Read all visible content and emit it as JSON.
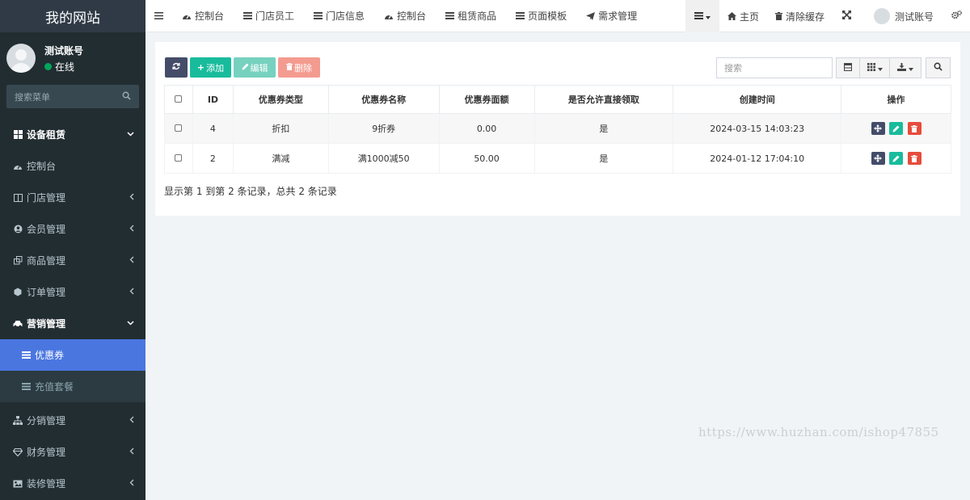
{
  "sidebar": {
    "logo": "我的网站",
    "user": {
      "name": "测试账号",
      "status": "在线"
    },
    "search_placeholder": "搜索菜单",
    "items": [
      {
        "label": "设备租赁",
        "icon": "grid-icon"
      },
      {
        "label": "控制台",
        "icon": "dashboard-icon"
      },
      {
        "label": "门店管理",
        "icon": "columns-icon"
      },
      {
        "label": "会员管理",
        "icon": "user-circle-icon"
      },
      {
        "label": "商品管理",
        "icon": "clone-icon"
      },
      {
        "label": "订单管理",
        "icon": "cube-icon"
      },
      {
        "label": "营销管理",
        "icon": "car-icon"
      },
      {
        "label": "优惠券",
        "icon": "list-icon"
      },
      {
        "label": "充值套餐",
        "icon": "list-icon"
      },
      {
        "label": "分销管理",
        "icon": "sitemap-icon"
      },
      {
        "label": "财务管理",
        "icon": "diamond-icon"
      },
      {
        "label": "装修管理",
        "icon": "image-icon"
      }
    ]
  },
  "topbar": {
    "tabs": [
      {
        "label": "控制台",
        "icon": "dashboard-icon"
      },
      {
        "label": "门店员工",
        "icon": "list-icon"
      },
      {
        "label": "门店信息",
        "icon": "list-icon"
      },
      {
        "label": "控制台",
        "icon": "dashboard-icon"
      },
      {
        "label": "租赁商品",
        "icon": "list-icon"
      },
      {
        "label": "页面模板",
        "icon": "list-icon"
      },
      {
        "label": "需求管理",
        "icon": "paper-plane-icon"
      }
    ],
    "home": "主页",
    "clear_cache": "清除缓存",
    "account": "测试账号"
  },
  "toolbar": {
    "add": "添加",
    "edit": "编辑",
    "delete": "删除",
    "search_placeholder": "搜索"
  },
  "table": {
    "columns": [
      "ID",
      "优惠券类型",
      "优惠券名称",
      "优惠券面额",
      "是否允许直接领取",
      "创建时间",
      "操作"
    ],
    "rows": [
      {
        "id": "4",
        "type": "折扣",
        "name": "9折券",
        "amount": "0.00",
        "allow": "是",
        "created": "2024-03-15 14:03:23"
      },
      {
        "id": "2",
        "type": "满减",
        "name": "满1000减50",
        "amount": "50.00",
        "allow": "是",
        "created": "2024-01-12 17:04:10"
      }
    ],
    "summary": "显示第 1 到第 2 条记录，总共 2 条记录"
  },
  "watermark": "https://www.huzhan.com/ishop47855",
  "colors": {
    "sidebar_bg": "#222d32",
    "accent": "#4a76e0",
    "success": "#18bc9c",
    "danger": "#e74c3c"
  }
}
